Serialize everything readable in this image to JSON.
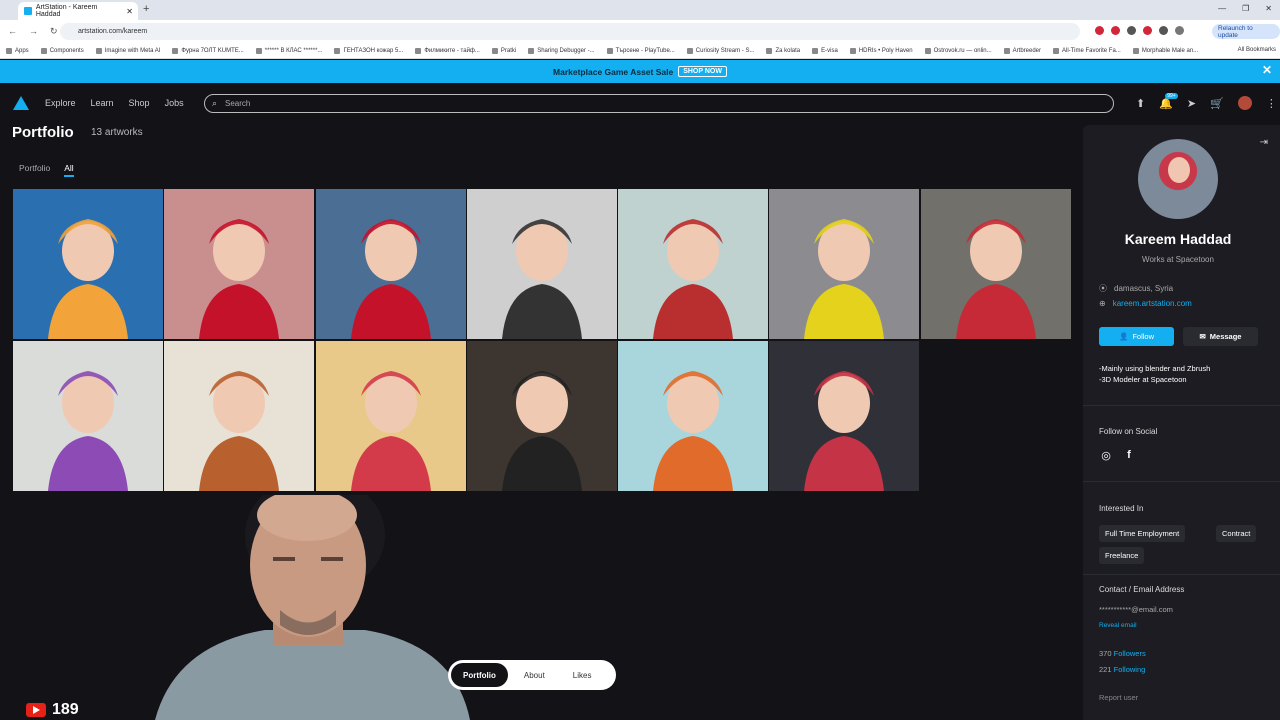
{
  "browser": {
    "tab_title": "ArtStation - Kareem Haddad",
    "url": "artstation.com/kareem",
    "relaunch_label": "Relaunch to update",
    "bookmarks": [
      "Apps",
      "Components",
      "Imagine with Meta AI",
      "Фурна 7ОЛТ KUMTE...",
      "****** В КЛАС ******...",
      "ГЕНТАЗОН кожар 5...",
      "Филмиките - тайф...",
      "Pratki",
      "Sharing Debugger -...",
      "Търсене - PlayTube...",
      "Curiosity Stream - S...",
      "Za kolata",
      "E-visa",
      "HDRIs • Poly Haven",
      "Ostrovok.ru — onlin...",
      "Artbreeder",
      "All-Time Favorite Fa...",
      "Morphable Male an..."
    ],
    "all_bookmarks": "All Bookmarks"
  },
  "promo": {
    "text": "Marketplace Game Asset Sale",
    "cta": "SHOP NOW"
  },
  "nav": {
    "explore": "Explore",
    "learn": "Learn",
    "shop": "Shop",
    "jobs": "Jobs",
    "search_placeholder": "Search",
    "notif_badge": "99+"
  },
  "portfolio": {
    "title": "Portfolio",
    "count": "13 artworks",
    "tabs": [
      "Portfolio",
      "All"
    ],
    "artworks": [
      {
        "name": "chef-kid",
        "bg": "#2a6fb0",
        "accent": "#f2a33a"
      },
      {
        "name": "girl-bob-red-1",
        "bg": "#c98f8f",
        "accent": "#c4122b"
      },
      {
        "name": "girl-bob-red-2",
        "bg": "#4b6e95",
        "accent": "#c4122b"
      },
      {
        "name": "ninja-woman",
        "bg": "#cfcfcf",
        "accent": "#333333"
      },
      {
        "name": "book-shop",
        "bg": "#bfd2cf",
        "accent": "#b92e2e"
      },
      {
        "name": "robot-girl",
        "bg": "#8c8c90",
        "accent": "#e4d21c"
      },
      {
        "name": "red-hair-warrior",
        "bg": "#71706b",
        "accent": "#c62a36"
      },
      {
        "name": "purple-hair-girl",
        "bg": "#d9dcd8",
        "accent": "#8c4bb5"
      },
      {
        "name": "autumn-woman",
        "bg": "#e8e2d6",
        "accent": "#b8612f"
      },
      {
        "name": "green-alien",
        "bg": "#e9c98a",
        "accent": "#d33b4a"
      },
      {
        "name": "samurai-boy",
        "bg": "#3d3530",
        "accent": "#222222"
      },
      {
        "name": "orange-ponytail",
        "bg": "#a9d5dc",
        "accent": "#e06b2a"
      },
      {
        "name": "cat-girl",
        "bg": "#2f3038",
        "accent": "#c43346"
      }
    ]
  },
  "profile": {
    "name": "Kareem Haddad",
    "job": "Works at Spacetoon",
    "location": "damascus, Syria",
    "website": "kareem.artstation.com",
    "follow": "Follow",
    "message": "Message",
    "bio_line1": "-Mainly using blender and Zbrush",
    "bio_line2": "-3D Modeler at Spacetoon",
    "follow_social": "Follow on Social",
    "interested_in": "Interested In",
    "interests": [
      "Full Time Employment",
      "Contract",
      "Freelance"
    ],
    "contact_title": "Contact / Email Address",
    "email": "***********@email.com",
    "reveal": "Reveal email",
    "followers_count": "370",
    "followers_label": "Followers",
    "following_count": "221",
    "following_label": "Following",
    "report": "Report user"
  },
  "bottom_tabs": [
    "Portfolio",
    "About",
    "Likes"
  ],
  "overlay": {
    "subscriber_count": "189"
  },
  "colors": {
    "accent": "#13aff0",
    "bg": "#121217",
    "panel": "#1c1c22"
  }
}
